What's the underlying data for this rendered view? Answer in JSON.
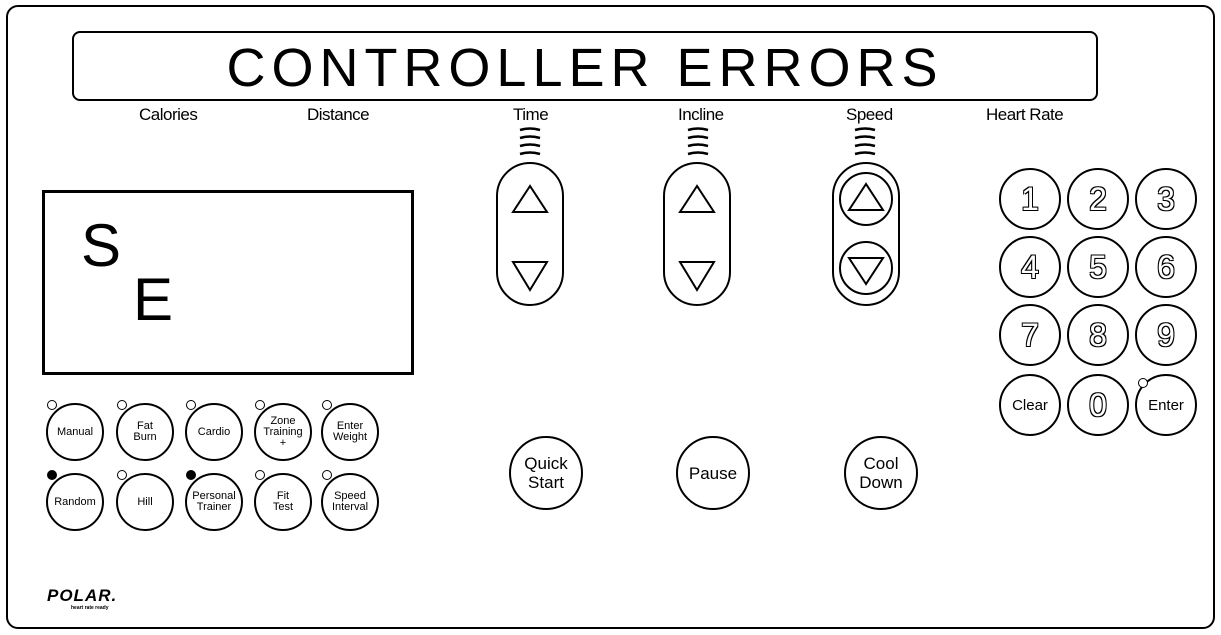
{
  "title": "CONTROLLER ERRORS",
  "readouts": {
    "calories": "Calories",
    "distance": "Distance",
    "time": "Time",
    "incline": "Incline",
    "speed": "Speed",
    "heart_rate": "Heart Rate"
  },
  "display": {
    "char1": "S",
    "char2": "E"
  },
  "programs": [
    {
      "label": "Manual",
      "led": "off"
    },
    {
      "label": "Fat\nBurn",
      "led": "off"
    },
    {
      "label": "Cardio",
      "led": "off"
    },
    {
      "label": "Zone\nTraining\n+",
      "led": "off"
    },
    {
      "label": "Enter\nWeight",
      "led": "off"
    },
    {
      "label": "Random",
      "led": "on"
    },
    {
      "label": "Hill",
      "led": "off"
    },
    {
      "label": "Personal\nTrainer",
      "led": "on"
    },
    {
      "label": "Fit\nTest",
      "led": "off"
    },
    {
      "label": "Speed\nInterval",
      "led": "off"
    }
  ],
  "controls": {
    "quick_start": "Quick\nStart",
    "pause": "Pause",
    "cool_down": "Cool\nDown"
  },
  "keypad": [
    "1",
    "2",
    "3",
    "4",
    "5",
    "6",
    "7",
    "8",
    "9",
    "Clear",
    "0",
    "Enter"
  ],
  "logo": {
    "brand": "POLAR.",
    "tagline": "heart rate ready"
  },
  "icons": [
    "up-arrow-icon",
    "down-arrow-icon",
    "indicator-bars-icon",
    "led-indicator-icon"
  ]
}
